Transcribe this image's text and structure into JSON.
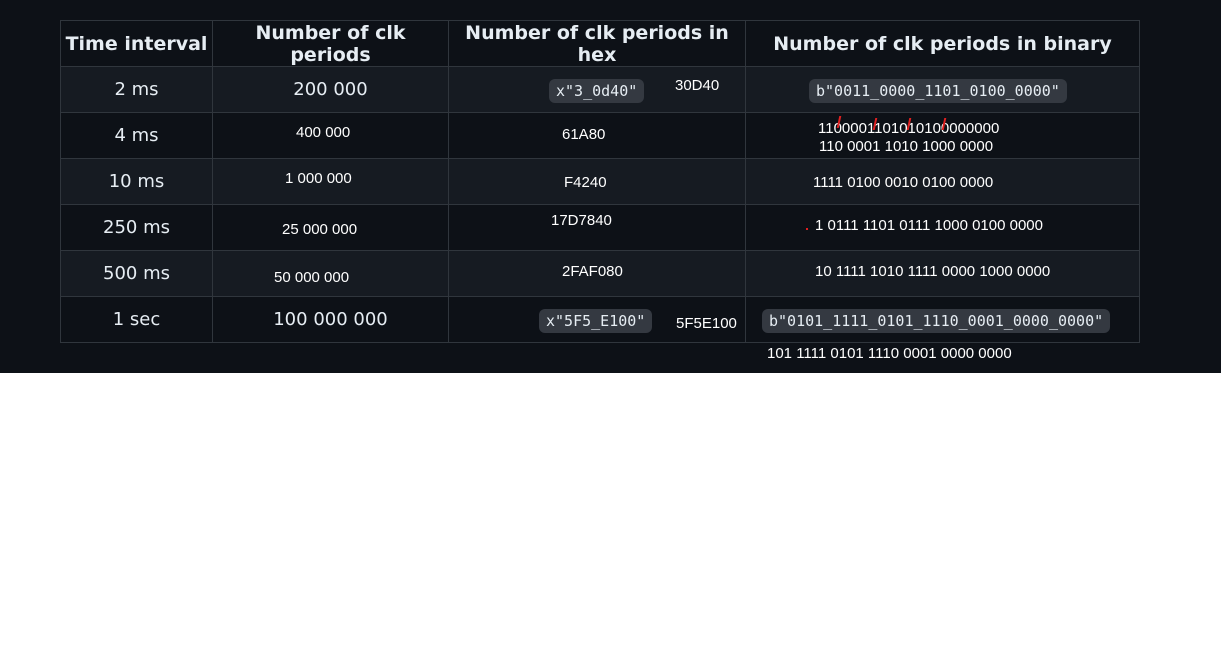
{
  "table": {
    "headers": [
      "Time interval",
      "Number of clk periods",
      "Number of clk periods in hex",
      "Number of clk periods in binary"
    ],
    "rows": [
      {
        "time": "2 ms",
        "count": "200 000",
        "hex_code": "x\"3_0d40\"",
        "hex_note": "30D40",
        "bin_code": "b\"0011_0000_1101_0100_0000\""
      },
      {
        "time": "4 ms",
        "count": "400 000",
        "hex_note": "61A80",
        "bin_note": "1100001101010100000000",
        "bin_note2": "110 0001 1010 1000 0000"
      },
      {
        "time": "10 ms",
        "count": "1 000 000",
        "hex_note": "F4240",
        "bin_note": "1111 0100 0010 0100 0000"
      },
      {
        "time": "250 ms",
        "count": "25 000 000",
        "hex_note": "17D7840",
        "bin_note": "1 0111 1101 0111 1000 0100 0000"
      },
      {
        "time": "500 ms",
        "count": "50 000 000",
        "hex_note": "2FAF080",
        "bin_note": "10 1111 1010 1111 0000 1000 0000"
      },
      {
        "time": "1 sec",
        "count": "100 000 000",
        "hex_code": "x\"5F5_E100\"",
        "hex_note": "5F5E100",
        "bin_code": "b\"0101_1111_0101_1110_0001_0000_0000\""
      }
    ]
  },
  "below_note": "101 1111 0101 1110 0001 0000 0000",
  "colors": {
    "background": "#0d1117",
    "row_alt": "#161b22",
    "border": "#30363d",
    "annotation_red": "#e02020"
  }
}
